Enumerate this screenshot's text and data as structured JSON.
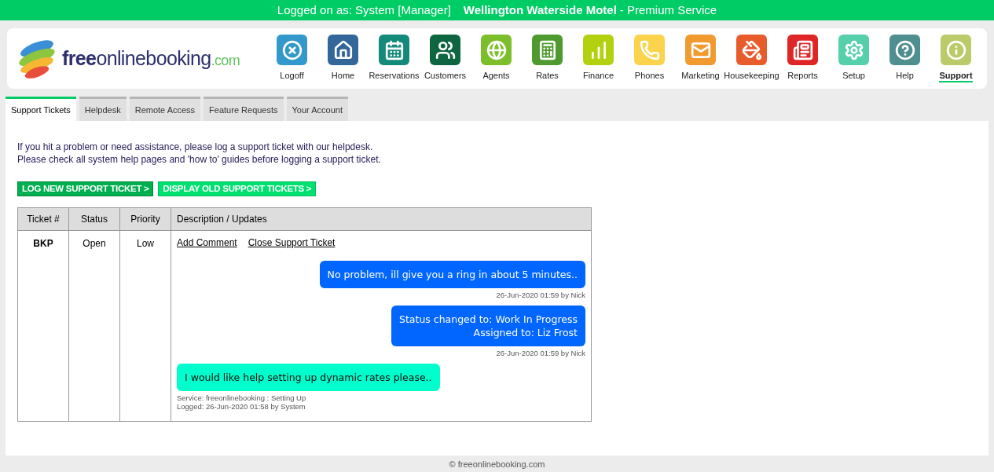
{
  "top_bar": {
    "login": "Logged on as: System [Manager]",
    "property": "Wellington Waterside Motel",
    "service": "- Premium Service"
  },
  "logo": {
    "bold": "free",
    "regular": "onlinebooking",
    "suffix": ".com"
  },
  "nav": [
    {
      "label": "Logoff",
      "color": "#3399cc",
      "selected": false
    },
    {
      "label": "Home",
      "color": "#336699",
      "selected": false
    },
    {
      "label": "Reservations",
      "color": "#138a7a",
      "selected": false
    },
    {
      "label": "Customers",
      "color": "#0e6640",
      "selected": false
    },
    {
      "label": "Agents",
      "color": "#7cbf2a",
      "selected": false
    },
    {
      "label": "Rates",
      "color": "#4f9a2e",
      "selected": false
    },
    {
      "label": "Finance",
      "color": "#b3d10f",
      "selected": false
    },
    {
      "label": "Phones",
      "color": "#fbd34d",
      "selected": false
    },
    {
      "label": "Marketing",
      "color": "#f09a30",
      "selected": false
    },
    {
      "label": "Housekeeping",
      "color": "#e85c2c",
      "selected": false
    },
    {
      "label": "Reports",
      "color": "#de2626",
      "selected": false
    },
    {
      "label": "Setup",
      "color": "#55d0aa",
      "selected": false
    },
    {
      "label": "Help",
      "color": "#4f8f8f",
      "selected": false
    },
    {
      "label": "Support",
      "color": "#bccb6a",
      "selected": true
    }
  ],
  "tabs": [
    {
      "label": "Support Tickets",
      "selected": true
    },
    {
      "label": "Helpdesk",
      "selected": false
    },
    {
      "label": "Remote Access",
      "selected": false
    },
    {
      "label": "Feature Requests",
      "selected": false
    },
    {
      "label": "Your Account",
      "selected": false
    }
  ],
  "intro": [
    "If you hit a problem or need assistance, please log a support ticket with our helpdesk.",
    "Please check all system help pages and 'how to' guides before logging a support ticket."
  ],
  "actions": [
    {
      "label": "LOG NEW SUPPORT TICKET >",
      "selected": true
    },
    {
      "label": "DISPLAY OLD SUPPORT TICKETS >",
      "selected": false
    }
  ],
  "table": {
    "columns": [
      "Ticket #",
      "Status",
      "Priority",
      "Description / Updates"
    ],
    "rows": [
      {
        "ticket": "BKP",
        "status": "Open",
        "priority": "Low",
        "links": [
          "Add Comment",
          "Close Support Ticket"
        ],
        "messages": [
          {
            "kind": "staff",
            "lines": [
              "No problem, ill give you a ring in about 5 minutes.."
            ],
            "meta": [
              "26-Jun-2020 01:59 by Nick"
            ]
          },
          {
            "kind": "staff",
            "lines": [
              "Status changed to: Work In Progress",
              "Assigned to: Liz Frost"
            ],
            "meta": [
              "26-Jun-2020 01:59 by Nick"
            ]
          },
          {
            "kind": "customer",
            "lines": [
              "I would like help setting up dynamic rates please.."
            ],
            "meta": [
              "Service: freeonlinebooking : Setting Up",
              "Logged: 26-Jun-2020 01:58 by System"
            ]
          }
        ]
      }
    ]
  },
  "footer": "© freeonlinebooking.com"
}
